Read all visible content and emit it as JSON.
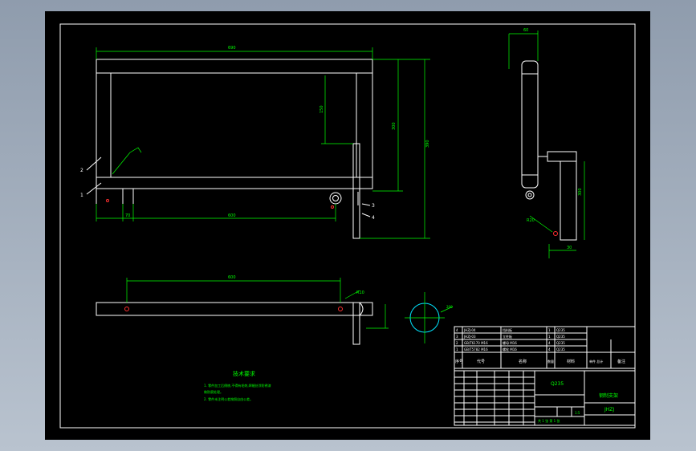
{
  "dims": {
    "top_length": "690",
    "top_height": "390",
    "inner_height": "300",
    "dim_150": "150",
    "bottom_length": "600",
    "dim_70": "70",
    "side_width": "60",
    "side_height": "300",
    "side_base": "30",
    "plan_length": "600",
    "note_a": "R10",
    "note_b": "R20",
    "note_c": "200"
  },
  "balloons": [
    "1",
    "2",
    "3",
    "4"
  ],
  "tech_title": "技术要求",
  "tech_lines": [
    "1. 零件加工后倒棱,不得有毛刺,焊缝处涂防锈漆",
    "   做防腐处理。",
    "2. 零件未注明公差按照自由公差。"
  ],
  "bom": [
    [
      "4",
      "JHZJ-04",
      "挡料板",
      "1",
      "Q235"
    ],
    [
      "3",
      "JHZJ-03",
      "立柱板",
      "1",
      "Q235"
    ],
    [
      "2",
      "GB/T6170 M16",
      "螺母 M16",
      "4",
      "Q235"
    ],
    [
      "1",
      "GB/T5782 M16",
      "螺栓 M16",
      "4",
      "Q235"
    ]
  ],
  "bom_header": [
    "序号",
    "代号",
    "名称",
    "数量",
    "材料",
    "单件 总计",
    "备注"
  ],
  "title_block": {
    "material": "Q235",
    "drawing_name": "钢制支架",
    "drawing_no": "JHZJ",
    "scale": "1:5",
    "sheets": "共 1 张 第 1 张"
  }
}
